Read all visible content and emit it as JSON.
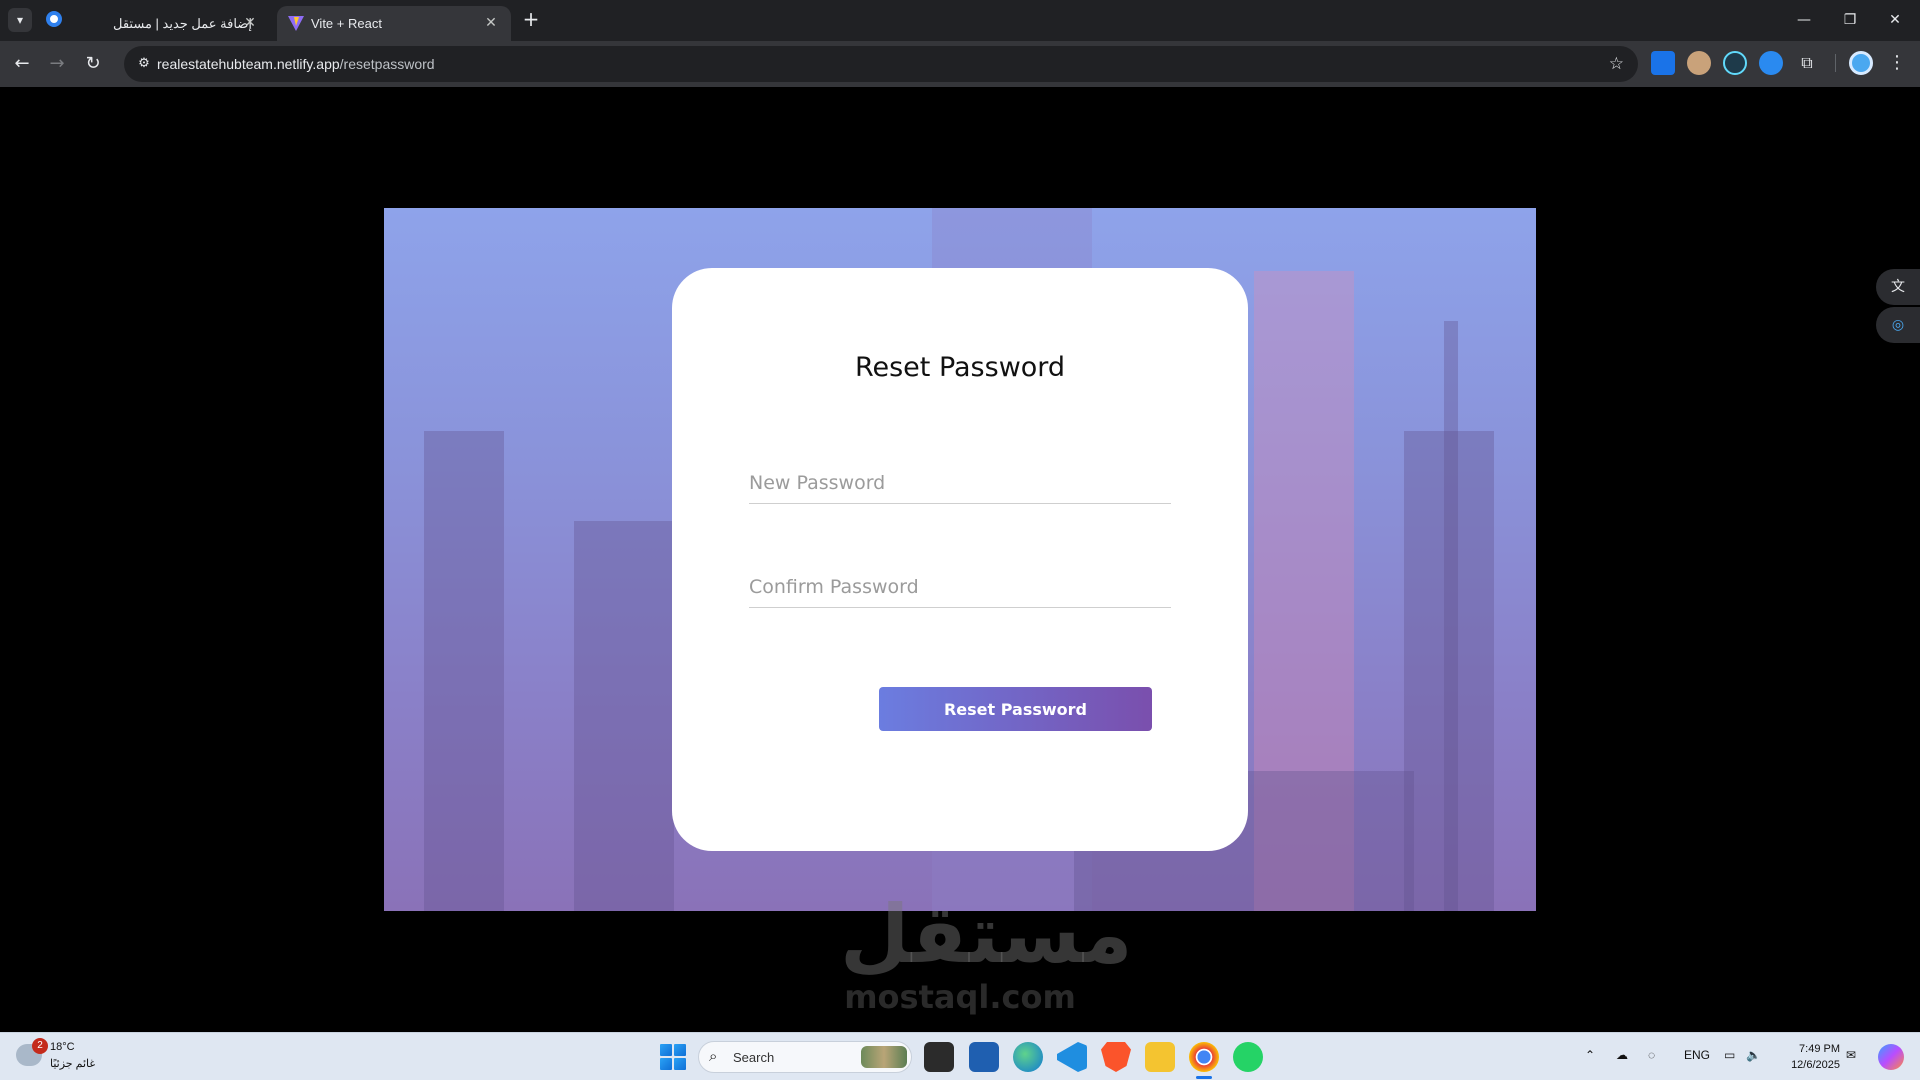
{
  "browser": {
    "tabs": [
      {
        "title": "إضافة عمل جديد | مستقل",
        "active": false
      },
      {
        "title": "Vite + React",
        "active": true
      }
    ],
    "url_host": "realestatehubteam.netlify.app",
    "url_path": "/resetpassword"
  },
  "form": {
    "title": "Reset Password",
    "new_password_placeholder": "New Password",
    "confirm_password_placeholder": "Confirm Password",
    "submit_label": "Reset Password",
    "button_gradient": [
      "#6b7de0",
      "#7a4fad"
    ]
  },
  "watermark": {
    "arabic": "مستقل",
    "latin": "mostaql.com"
  },
  "taskbar": {
    "weather_badge": "2",
    "weather_temp": "18°C",
    "weather_condition": "غائم جزئيًا",
    "search_label": "Search",
    "language": "ENG",
    "time": "7:49 PM",
    "date": "12/6/2025"
  }
}
